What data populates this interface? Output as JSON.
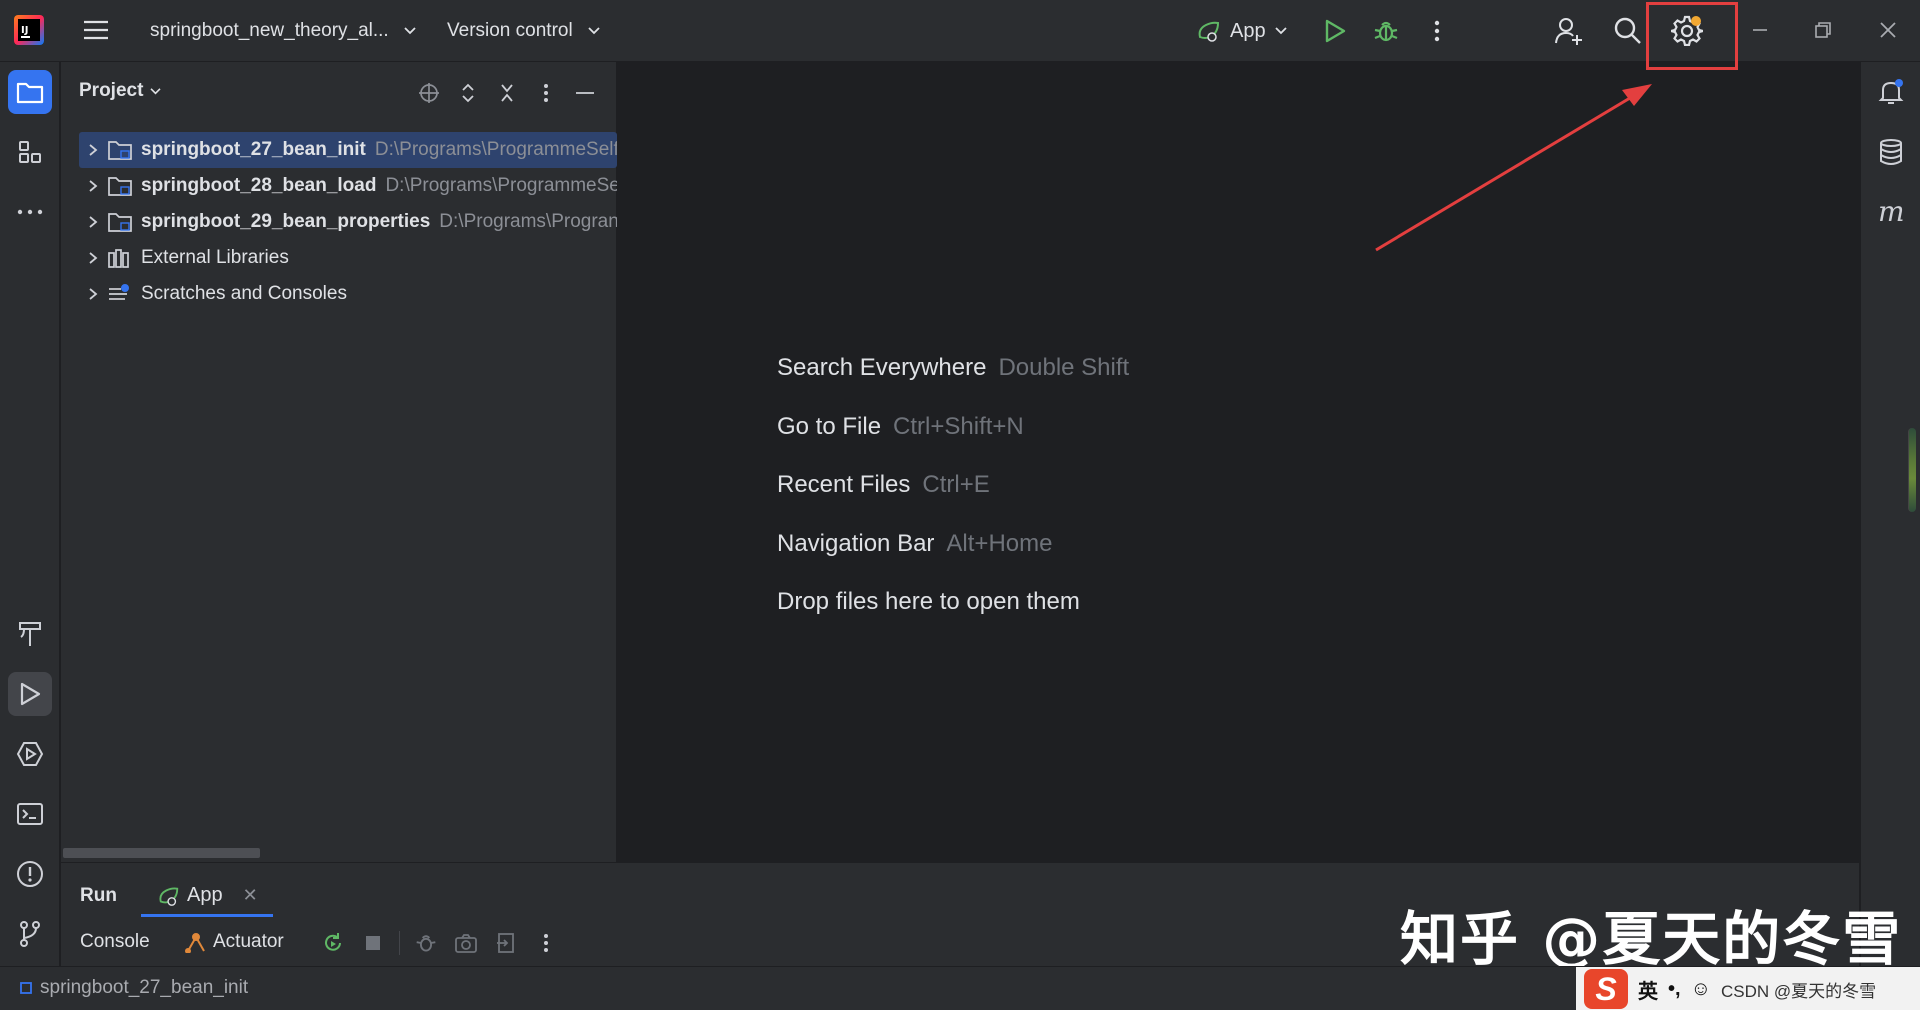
{
  "titlebar": {
    "project_name": "springboot_new_theory_al...",
    "vcs_label": "Version control",
    "run_config": "App"
  },
  "project_panel": {
    "title": "Project",
    "items": [
      {
        "name": "springboot_27_bean_init",
        "path": "D:\\Programs\\ProgrammeSelf",
        "bold": true,
        "selected": true
      },
      {
        "name": "springboot_28_bean_load",
        "path": "D:\\Programs\\ProgrammeSe",
        "bold": true,
        "selected": false
      },
      {
        "name": "springboot_29_bean_properties",
        "path": "D:\\Programs\\Progran",
        "bold": true,
        "selected": false
      },
      {
        "name": "External Libraries",
        "path": "",
        "bold": false,
        "selected": false
      },
      {
        "name": "Scratches and Consoles",
        "path": "",
        "bold": false,
        "selected": false
      }
    ]
  },
  "editor_hints": [
    {
      "action": "Search Everywhere",
      "shortcut": "Double Shift"
    },
    {
      "action": "Go to File",
      "shortcut": "Ctrl+Shift+N"
    },
    {
      "action": "Recent Files",
      "shortcut": "Ctrl+E"
    },
    {
      "action": "Navigation Bar",
      "shortcut": "Alt+Home"
    },
    {
      "action": "Drop files here to open them",
      "shortcut": ""
    }
  ],
  "run_panel": {
    "title": "Run",
    "tab_label": "App",
    "console_label": "Console",
    "actuator_label": "Actuator"
  },
  "status_bar": {
    "breadcrumb": "springboot_27_bean_init"
  },
  "watermark": "知乎 @夏天的冬雪",
  "ime": {
    "lang": "英",
    "punct": "•,",
    "csdn": "CSDN @夏天的冬雪"
  },
  "colors": {
    "accent": "#3574f0",
    "highlight": "#e33f3f",
    "run_green": "#5fb865",
    "settings_badge": "#f2a832"
  },
  "icons": [
    "hamburger-icon",
    "chevron-down-icon",
    "run-config-icon",
    "play-icon",
    "debug-icon",
    "more-vertical-icon",
    "add-user-icon",
    "search-icon",
    "gear-icon",
    "minimize-icon",
    "restore-icon",
    "close-icon",
    "folder-icon",
    "structure-icon",
    "more-horizontal-icon",
    "build-icon",
    "run-icon",
    "services-icon",
    "terminal-icon",
    "problems-icon",
    "git-icon",
    "notifications-icon",
    "database-icon",
    "maven-icon"
  ]
}
